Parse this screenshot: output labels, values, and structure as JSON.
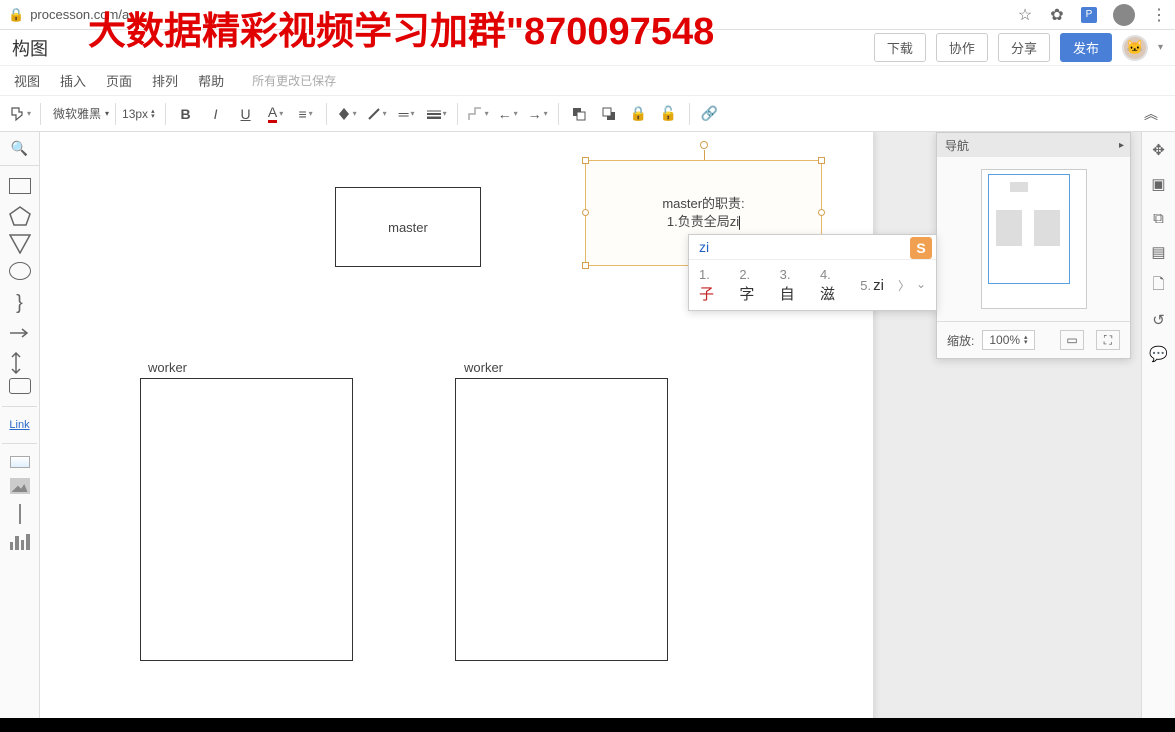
{
  "browser": {
    "url": "processon.com/a",
    "overlay_text": "大数据精彩视频学习加群\"870097548"
  },
  "header": {
    "doc_title": "构图",
    "buttons": {
      "download": "下载",
      "collab": "协作",
      "share": "分享",
      "publish": "发布"
    }
  },
  "menu": {
    "items": [
      "视图",
      "插入",
      "页面",
      "排列",
      "帮助"
    ],
    "save_status": "所有更改已保存"
  },
  "toolbar": {
    "font_family": "微软雅黑",
    "font_size": "13px"
  },
  "palette": {
    "link_label": "Link"
  },
  "canvas": {
    "master_label": "master",
    "text_box_line1": "master的职责:",
    "text_box_line2": "1.负责全局zi",
    "worker1_label": "worker",
    "worker2_label": "worker"
  },
  "ime": {
    "input": "zi",
    "candidates": [
      {
        "num": "1.",
        "char": "子"
      },
      {
        "num": "2.",
        "char": "字"
      },
      {
        "num": "3.",
        "char": "自"
      },
      {
        "num": "4.",
        "char": "滋"
      },
      {
        "num": "5.",
        "char": "zi"
      }
    ]
  },
  "navigator": {
    "title": "导航",
    "zoom_label": "缩放:",
    "zoom_value": "100%"
  }
}
